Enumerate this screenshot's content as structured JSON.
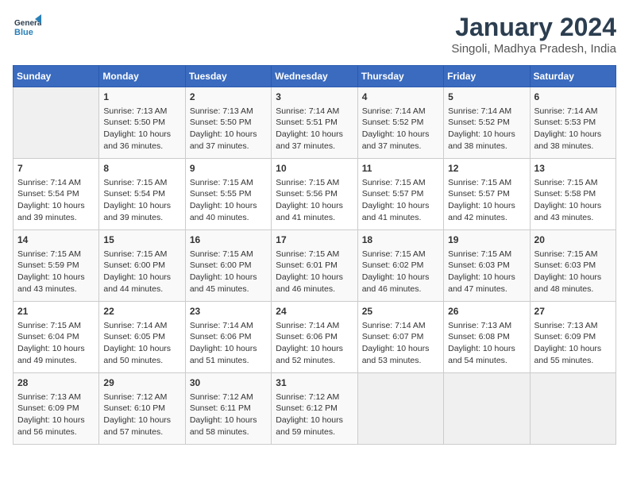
{
  "header": {
    "logo_line1": "General",
    "logo_line2": "Blue",
    "title": "January 2024",
    "subtitle": "Singoli, Madhya Pradesh, India"
  },
  "weekdays": [
    "Sunday",
    "Monday",
    "Tuesday",
    "Wednesday",
    "Thursday",
    "Friday",
    "Saturday"
  ],
  "weeks": [
    [
      {
        "day": "",
        "sunrise": "",
        "sunset": "",
        "daylight": ""
      },
      {
        "day": "1",
        "sunrise": "Sunrise: 7:13 AM",
        "sunset": "Sunset: 5:50 PM",
        "daylight": "Daylight: 10 hours and 36 minutes."
      },
      {
        "day": "2",
        "sunrise": "Sunrise: 7:13 AM",
        "sunset": "Sunset: 5:50 PM",
        "daylight": "Daylight: 10 hours and 37 minutes."
      },
      {
        "day": "3",
        "sunrise": "Sunrise: 7:14 AM",
        "sunset": "Sunset: 5:51 PM",
        "daylight": "Daylight: 10 hours and 37 minutes."
      },
      {
        "day": "4",
        "sunrise": "Sunrise: 7:14 AM",
        "sunset": "Sunset: 5:52 PM",
        "daylight": "Daylight: 10 hours and 37 minutes."
      },
      {
        "day": "5",
        "sunrise": "Sunrise: 7:14 AM",
        "sunset": "Sunset: 5:52 PM",
        "daylight": "Daylight: 10 hours and 38 minutes."
      },
      {
        "day": "6",
        "sunrise": "Sunrise: 7:14 AM",
        "sunset": "Sunset: 5:53 PM",
        "daylight": "Daylight: 10 hours and 38 minutes."
      }
    ],
    [
      {
        "day": "7",
        "sunrise": "Sunrise: 7:14 AM",
        "sunset": "Sunset: 5:54 PM",
        "daylight": "Daylight: 10 hours and 39 minutes."
      },
      {
        "day": "8",
        "sunrise": "Sunrise: 7:15 AM",
        "sunset": "Sunset: 5:54 PM",
        "daylight": "Daylight: 10 hours and 39 minutes."
      },
      {
        "day": "9",
        "sunrise": "Sunrise: 7:15 AM",
        "sunset": "Sunset: 5:55 PM",
        "daylight": "Daylight: 10 hours and 40 minutes."
      },
      {
        "day": "10",
        "sunrise": "Sunrise: 7:15 AM",
        "sunset": "Sunset: 5:56 PM",
        "daylight": "Daylight: 10 hours and 41 minutes."
      },
      {
        "day": "11",
        "sunrise": "Sunrise: 7:15 AM",
        "sunset": "Sunset: 5:57 PM",
        "daylight": "Daylight: 10 hours and 41 minutes."
      },
      {
        "day": "12",
        "sunrise": "Sunrise: 7:15 AM",
        "sunset": "Sunset: 5:57 PM",
        "daylight": "Daylight: 10 hours and 42 minutes."
      },
      {
        "day": "13",
        "sunrise": "Sunrise: 7:15 AM",
        "sunset": "Sunset: 5:58 PM",
        "daylight": "Daylight: 10 hours and 43 minutes."
      }
    ],
    [
      {
        "day": "14",
        "sunrise": "Sunrise: 7:15 AM",
        "sunset": "Sunset: 5:59 PM",
        "daylight": "Daylight: 10 hours and 43 minutes."
      },
      {
        "day": "15",
        "sunrise": "Sunrise: 7:15 AM",
        "sunset": "Sunset: 6:00 PM",
        "daylight": "Daylight: 10 hours and 44 minutes."
      },
      {
        "day": "16",
        "sunrise": "Sunrise: 7:15 AM",
        "sunset": "Sunset: 6:00 PM",
        "daylight": "Daylight: 10 hours and 45 minutes."
      },
      {
        "day": "17",
        "sunrise": "Sunrise: 7:15 AM",
        "sunset": "Sunset: 6:01 PM",
        "daylight": "Daylight: 10 hours and 46 minutes."
      },
      {
        "day": "18",
        "sunrise": "Sunrise: 7:15 AM",
        "sunset": "Sunset: 6:02 PM",
        "daylight": "Daylight: 10 hours and 46 minutes."
      },
      {
        "day": "19",
        "sunrise": "Sunrise: 7:15 AM",
        "sunset": "Sunset: 6:03 PM",
        "daylight": "Daylight: 10 hours and 47 minutes."
      },
      {
        "day": "20",
        "sunrise": "Sunrise: 7:15 AM",
        "sunset": "Sunset: 6:03 PM",
        "daylight": "Daylight: 10 hours and 48 minutes."
      }
    ],
    [
      {
        "day": "21",
        "sunrise": "Sunrise: 7:15 AM",
        "sunset": "Sunset: 6:04 PM",
        "daylight": "Daylight: 10 hours and 49 minutes."
      },
      {
        "day": "22",
        "sunrise": "Sunrise: 7:14 AM",
        "sunset": "Sunset: 6:05 PM",
        "daylight": "Daylight: 10 hours and 50 minutes."
      },
      {
        "day": "23",
        "sunrise": "Sunrise: 7:14 AM",
        "sunset": "Sunset: 6:06 PM",
        "daylight": "Daylight: 10 hours and 51 minutes."
      },
      {
        "day": "24",
        "sunrise": "Sunrise: 7:14 AM",
        "sunset": "Sunset: 6:06 PM",
        "daylight": "Daylight: 10 hours and 52 minutes."
      },
      {
        "day": "25",
        "sunrise": "Sunrise: 7:14 AM",
        "sunset": "Sunset: 6:07 PM",
        "daylight": "Daylight: 10 hours and 53 minutes."
      },
      {
        "day": "26",
        "sunrise": "Sunrise: 7:13 AM",
        "sunset": "Sunset: 6:08 PM",
        "daylight": "Daylight: 10 hours and 54 minutes."
      },
      {
        "day": "27",
        "sunrise": "Sunrise: 7:13 AM",
        "sunset": "Sunset: 6:09 PM",
        "daylight": "Daylight: 10 hours and 55 minutes."
      }
    ],
    [
      {
        "day": "28",
        "sunrise": "Sunrise: 7:13 AM",
        "sunset": "Sunset: 6:09 PM",
        "daylight": "Daylight: 10 hours and 56 minutes."
      },
      {
        "day": "29",
        "sunrise": "Sunrise: 7:12 AM",
        "sunset": "Sunset: 6:10 PM",
        "daylight": "Daylight: 10 hours and 57 minutes."
      },
      {
        "day": "30",
        "sunrise": "Sunrise: 7:12 AM",
        "sunset": "Sunset: 6:11 PM",
        "daylight": "Daylight: 10 hours and 58 minutes."
      },
      {
        "day": "31",
        "sunrise": "Sunrise: 7:12 AM",
        "sunset": "Sunset: 6:12 PM",
        "daylight": "Daylight: 10 hours and 59 minutes."
      },
      {
        "day": "",
        "sunrise": "",
        "sunset": "",
        "daylight": ""
      },
      {
        "day": "",
        "sunrise": "",
        "sunset": "",
        "daylight": ""
      },
      {
        "day": "",
        "sunrise": "",
        "sunset": "",
        "daylight": ""
      }
    ]
  ]
}
